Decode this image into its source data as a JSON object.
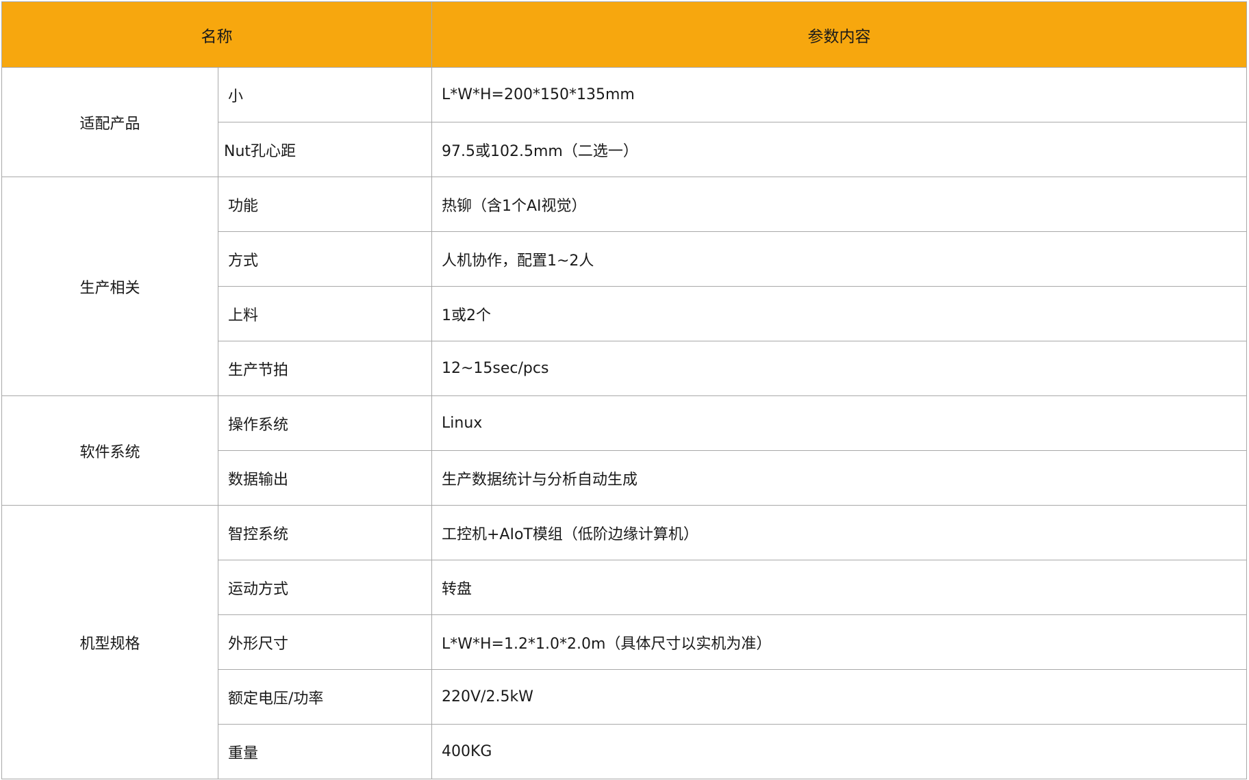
{
  "header": {
    "name_label": "名称",
    "content_label": "参数内容"
  },
  "groups": [
    {
      "name": "适配产品",
      "rows": [
        {
          "item": "小",
          "value": "L*W*H=200*150*135mm"
        },
        {
          "item": "Nut孔心距",
          "value": "97.5或102.5mm（二选一）"
        }
      ]
    },
    {
      "name": "生产相关",
      "rows": [
        {
          "item": "功能",
          "value": "热铆（含1个AI视觉）"
        },
        {
          "item": "方式",
          "value": "人机协作，配置1~2人"
        },
        {
          "item": "上料",
          "value": "1或2个"
        },
        {
          "item": "生产节拍",
          "value": "12~15sec/pcs"
        }
      ]
    },
    {
      "name": "软件系统",
      "rows": [
        {
          "item": "操作系统",
          "value": "Linux"
        },
        {
          "item": "数据输出",
          "value": "生产数据统计与分析自动生成"
        }
      ]
    },
    {
      "name": "机型规格",
      "rows": [
        {
          "item": "智控系统",
          "value": "工控机+AIoT模组（低阶边缘计算机）"
        },
        {
          "item": "运动方式",
          "value": "转盘"
        },
        {
          "item": "外形尺寸",
          "value": "L*W*H=1.2*1.0*2.0m（具体尺寸以实机为准）"
        },
        {
          "item": "额定电压/功率",
          "value": "220V/2.5kW"
        },
        {
          "item": "重量",
          "value": "400KG"
        }
      ]
    }
  ],
  "colors": {
    "header_bg": "#f7a70e",
    "border": "#a8a8a8"
  }
}
